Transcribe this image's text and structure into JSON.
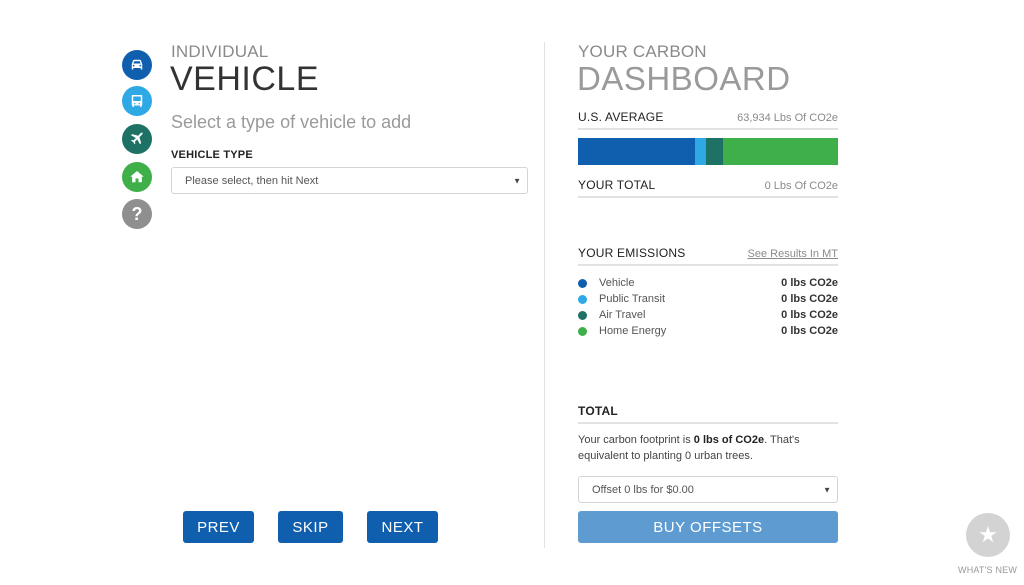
{
  "sidebar": {
    "items": [
      {
        "name": "vehicle",
        "icon": "car-icon",
        "color": "#0f5fae"
      },
      {
        "name": "public-transit",
        "icon": "bus-icon",
        "color": "#2ea9e6"
      },
      {
        "name": "air-travel",
        "icon": "airplane-icon",
        "color": "#1d7265"
      },
      {
        "name": "home-energy",
        "icon": "house-icon",
        "color": "#3faf4a"
      },
      {
        "name": "help",
        "icon": "question-icon",
        "color": "#8f8f8f",
        "glyph": "?"
      }
    ]
  },
  "left": {
    "eyebrow": "INDIVIDUAL",
    "title": "VEHICLE",
    "subtitle": "Select a type of vehicle to add",
    "field_label": "VEHICLE TYPE",
    "select_value": "Please select, then hit Next",
    "caret": "▼",
    "buttons": {
      "prev": "PREV",
      "skip": "SKIP",
      "next": "NEXT"
    }
  },
  "dashboard": {
    "eyebrow": "YOUR CARBON",
    "title": "DASHBOARD",
    "us_average": {
      "label": "U.S. AVERAGE",
      "value": "63,934 Lbs Of CO2e"
    },
    "avg_breakdown": [
      {
        "name": "Vehicle",
        "fraction": 0.45,
        "color": "#0f5fae"
      },
      {
        "name": "Public Transit",
        "fraction": 0.042,
        "color": "#2ea9e6"
      },
      {
        "name": "Air Travel",
        "fraction": 0.066,
        "color": "#1d7265"
      },
      {
        "name": "Home Energy",
        "fraction": 0.442,
        "color": "#3faf4a"
      }
    ],
    "your_total": {
      "label": "YOUR TOTAL",
      "value": "0 Lbs Of CO2e"
    },
    "emissions": {
      "label": "YOUR EMISSIONS",
      "link": "See Results In MT",
      "items": [
        {
          "name": "Vehicle",
          "value": "0 lbs CO2e",
          "color": "#0f5fae"
        },
        {
          "name": "Public Transit",
          "value": "0 lbs CO2e",
          "color": "#2ea9e6"
        },
        {
          "name": "Air Travel",
          "value": "0 lbs CO2e",
          "color": "#1d7265"
        },
        {
          "name": "Home Energy",
          "value": "0 lbs CO2e",
          "color": "#3faf4a"
        }
      ]
    },
    "total": {
      "label": "TOTAL",
      "text_pre": "Your carbon footprint is ",
      "text_bold": "0 lbs of CO2e",
      "text_post": ". That's equivalent to planting 0 urban trees."
    },
    "offset_select": "Offset 0 lbs for $0.00",
    "buy_label": "BUY OFFSETS"
  },
  "whats_new": {
    "label": "WHAT'S NEW",
    "glyph": "★"
  }
}
